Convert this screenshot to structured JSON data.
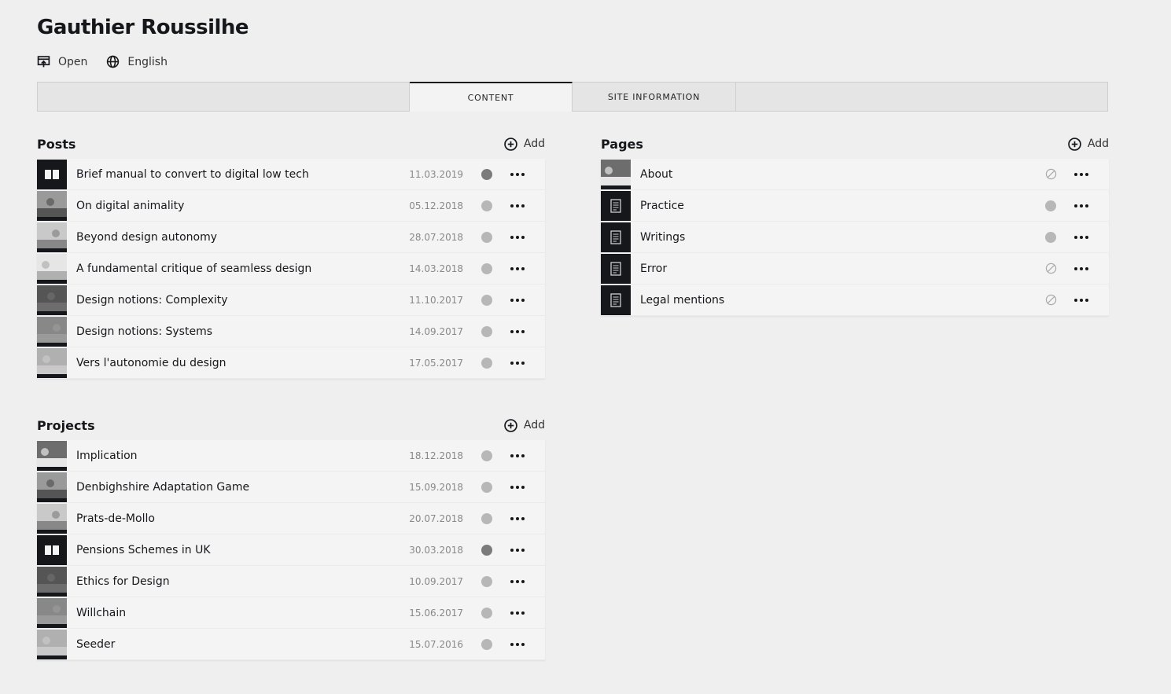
{
  "site": {
    "title": "Gauthier Roussilhe",
    "open_label": "Open",
    "language_label": "English"
  },
  "tabs": [
    {
      "label": "Content",
      "active": true
    },
    {
      "label": "Site information",
      "active": false
    }
  ],
  "posts": {
    "title": "Posts",
    "add_label": "Add",
    "items": [
      {
        "title": "Brief manual to convert to digital low tech",
        "date": "11.03.2019",
        "status": "listed",
        "thumb": "book-icon"
      },
      {
        "title": "On digital animality",
        "date": "05.12.2018",
        "status": "unlisted",
        "thumb": "image"
      },
      {
        "title": "Beyond design autonomy",
        "date": "28.07.2018",
        "status": "unlisted",
        "thumb": "image"
      },
      {
        "title": "A fundamental critique of seamless design",
        "date": "14.03.2018",
        "status": "unlisted",
        "thumb": "image"
      },
      {
        "title": "Design notions: Complexity",
        "date": "11.10.2017",
        "status": "unlisted",
        "thumb": "image"
      },
      {
        "title": "Design notions: Systems",
        "date": "14.09.2017",
        "status": "unlisted",
        "thumb": "image"
      },
      {
        "title": "Vers l'autonomie du design",
        "date": "17.05.2017",
        "status": "unlisted",
        "thumb": "image"
      }
    ]
  },
  "projects": {
    "title": "Projects",
    "add_label": "Add",
    "items": [
      {
        "title": "Implication",
        "date": "18.12.2018",
        "status": "unlisted",
        "thumb": "image"
      },
      {
        "title": "Denbighshire Adaptation Game",
        "date": "15.09.2018",
        "status": "unlisted",
        "thumb": "image"
      },
      {
        "title": "Prats-de-Mollo",
        "date": "20.07.2018",
        "status": "unlisted",
        "thumb": "image"
      },
      {
        "title": "Pensions Schemes in UK",
        "date": "30.03.2018",
        "status": "listed",
        "thumb": "book-icon"
      },
      {
        "title": "Ethics for Design",
        "date": "10.09.2017",
        "status": "unlisted",
        "thumb": "image"
      },
      {
        "title": "Willchain",
        "date": "15.06.2017",
        "status": "unlisted",
        "thumb": "image"
      },
      {
        "title": "Seeder",
        "date": "15.07.2016",
        "status": "unlisted",
        "thumb": "image"
      }
    ]
  },
  "pages": {
    "title": "Pages",
    "add_label": "Add",
    "items": [
      {
        "title": "About",
        "status": "draft",
        "thumb": "image"
      },
      {
        "title": "Practice",
        "status": "unlisted",
        "thumb": "page-icon"
      },
      {
        "title": "Writings",
        "status": "unlisted",
        "thumb": "page-icon"
      },
      {
        "title": "Error",
        "status": "draft",
        "thumb": "page-icon"
      },
      {
        "title": "Legal mentions",
        "status": "draft",
        "thumb": "page-icon"
      }
    ]
  },
  "colors": {
    "background": "#efefef",
    "text": "#16171a",
    "status_listed": "#7b7b7b",
    "status_unlisted": "#b7b7b7"
  }
}
